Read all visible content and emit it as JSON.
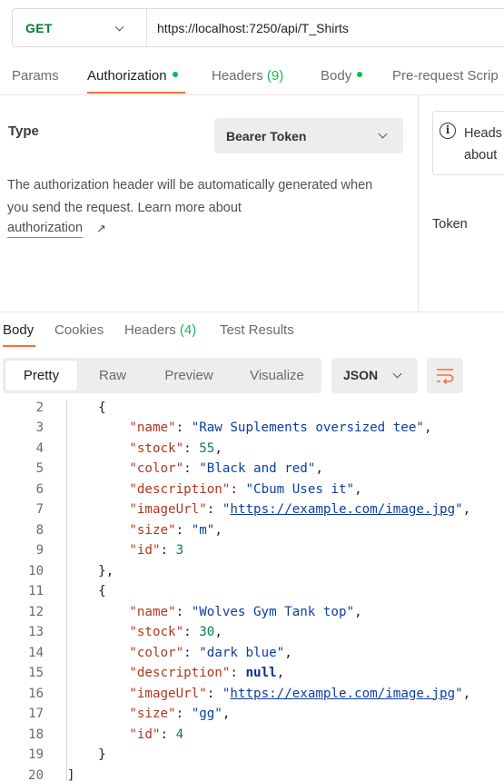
{
  "request": {
    "method": "GET",
    "url": "https://localhost:7250/api/T_Shirts"
  },
  "request_tabs": {
    "params": "Params",
    "authorization": "Authorization",
    "headers": "Headers",
    "headers_count": "(9)",
    "body": "Body",
    "prerequest": "Pre-request Scrip"
  },
  "auth": {
    "type_label": "Type",
    "type_value": "Bearer Token",
    "description": "The authorization header will be automatically generated when you send the request. Learn more about",
    "link": "authorization",
    "link_arrow": "↗",
    "info_text": "Heads about",
    "token_label": "Token"
  },
  "response_tabs": {
    "body": "Body",
    "cookies": "Cookies",
    "headers": "Headers",
    "headers_count": "(4)",
    "test_results": "Test Results"
  },
  "format": {
    "pretty": "Pretty",
    "raw": "Raw",
    "preview": "Preview",
    "visualize": "Visualize",
    "language": "JSON"
  },
  "code": {
    "line_numbers": [
      "2",
      "3",
      "4",
      "5",
      "6",
      "7",
      "8",
      "9",
      "10",
      "11",
      "12",
      "13",
      "14",
      "15",
      "16",
      "17",
      "18",
      "19",
      "20"
    ],
    "obj1": {
      "name": "\"Raw Suplements oversized tee\"",
      "stock": "55",
      "color": "\"Black and red\"",
      "description": "\"Cbum Uses it\"",
      "imageUrl": "https://example.com/image.jpg",
      "size": "\"m\"",
      "id": "3"
    },
    "obj2": {
      "name": "\"Wolves Gym Tank top\"",
      "stock": "30",
      "color": "\"dark blue\"",
      "description": "null",
      "imageUrl": "https://example.com/image.jpg",
      "size": "\"gg\"",
      "id": "4"
    },
    "keys": {
      "name": "\"name\"",
      "stock": "\"stock\"",
      "color": "\"color\"",
      "description": "\"description\"",
      "imageUrl": "\"imageUrl\"",
      "size": "\"size\"",
      "id": "\"id\""
    }
  },
  "colors": {
    "accent": "#ff6c37",
    "method_get": "#007f31",
    "dot": "#0cbb52"
  }
}
